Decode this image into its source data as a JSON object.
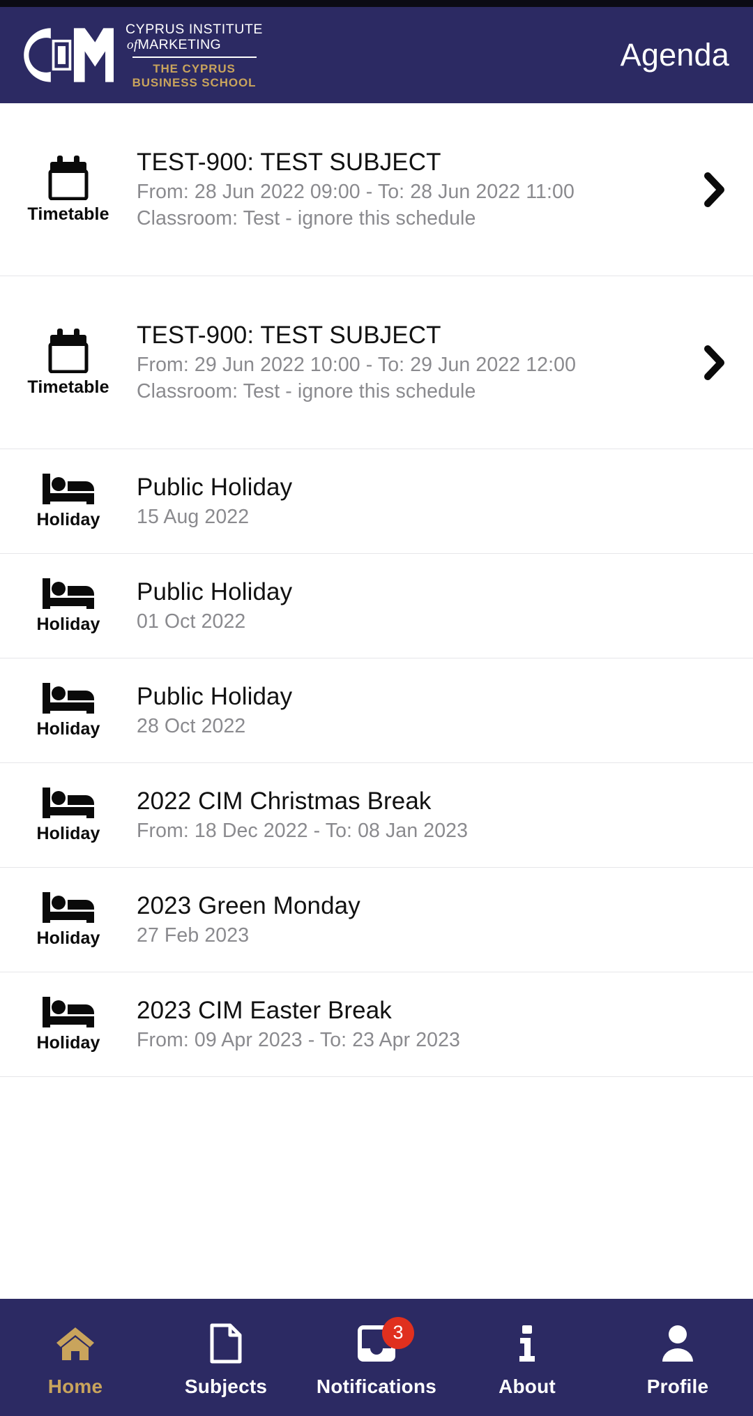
{
  "header": {
    "title": "Agenda",
    "brand": {
      "line1": "CYPRUS INSTITUTE",
      "line2_italic": "of",
      "line2": "MARKETING",
      "line3": "THE CYPRUS",
      "line4": "BUSINESS SCHOOL",
      "logo_icon": "cim-logo-icon"
    },
    "colors": {
      "header_bg": "#2c2a63",
      "gold": "#c9a45c",
      "badge_red": "#e0301e"
    }
  },
  "agenda": {
    "rows": [
      {
        "type": "timetable",
        "lead_label": "Timetable",
        "icon": "calendar-icon",
        "title": "TEST-900: TEST SUBJECT",
        "sub1": "From: 28 Jun 2022 09:00 - To: 28 Jun 2022 11:00",
        "sub2": "Classroom: Test - ignore this schedule",
        "chevron": "chevron-right-icon",
        "has_chevron": true
      },
      {
        "type": "timetable",
        "lead_label": "Timetable",
        "icon": "calendar-icon",
        "title": "TEST-900: TEST SUBJECT",
        "sub1": "From: 29 Jun 2022 10:00 - To: 29 Jun 2022 12:00",
        "sub2": "Classroom: Test - ignore this schedule",
        "chevron": "chevron-right-icon",
        "has_chevron": true
      },
      {
        "type": "holiday",
        "lead_label": "Holiday",
        "icon": "bed-icon",
        "title": "Public Holiday",
        "sub1": "15 Aug 2022",
        "sub2": "",
        "has_chevron": false
      },
      {
        "type": "holiday",
        "lead_label": "Holiday",
        "icon": "bed-icon",
        "title": "Public Holiday",
        "sub1": "01 Oct 2022",
        "sub2": "",
        "has_chevron": false
      },
      {
        "type": "holiday",
        "lead_label": "Holiday",
        "icon": "bed-icon",
        "title": "Public Holiday",
        "sub1": "28 Oct 2022",
        "sub2": "",
        "has_chevron": false
      },
      {
        "type": "holiday",
        "lead_label": "Holiday",
        "icon": "bed-icon",
        "title": "2022 CIM Christmas Break",
        "sub1": "From: 18 Dec 2022 - To: 08 Jan 2023",
        "sub2": "",
        "has_chevron": false
      },
      {
        "type": "holiday",
        "lead_label": "Holiday",
        "icon": "bed-icon",
        "title": "2023 Green Monday",
        "sub1": "27 Feb 2023",
        "sub2": "",
        "has_chevron": false
      },
      {
        "type": "holiday",
        "lead_label": "Holiday",
        "icon": "bed-icon",
        "title": "2023 CIM Easter Break",
        "sub1": "From: 09 Apr 2023 - To: 23 Apr 2023",
        "sub2": "",
        "has_chevron": false
      }
    ]
  },
  "bottom_nav": {
    "items": [
      {
        "label": "Home",
        "icon": "home-icon",
        "active": true,
        "badge": ""
      },
      {
        "label": "Subjects",
        "icon": "document-icon",
        "active": false,
        "badge": ""
      },
      {
        "label": "Notifications",
        "icon": "inbox-icon",
        "active": false,
        "badge": "3"
      },
      {
        "label": "About",
        "icon": "info-icon",
        "active": false,
        "badge": ""
      },
      {
        "label": "Profile",
        "icon": "person-icon",
        "active": false,
        "badge": ""
      }
    ]
  }
}
